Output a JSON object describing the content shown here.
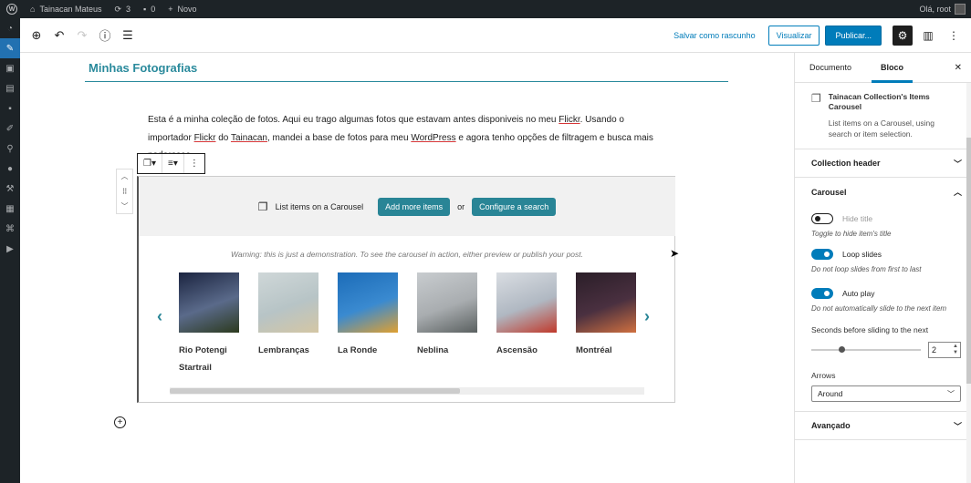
{
  "adminbar": {
    "site_name": "Tainacan Mateus",
    "updates": "3",
    "comments": "0",
    "new_label": "Novo",
    "greeting": "Olá, root"
  },
  "header": {
    "save_draft": "Salvar como rascunho",
    "preview": "Visualizar",
    "publish": "Publicar..."
  },
  "post": {
    "title": "Minhas Fotografias",
    "paragraph": {
      "p1": "Esta é a minha coleção de fotos. Aqui eu trago algumas fotos que estavam antes disponiveis no meu ",
      "flickr1": "Flickr",
      "p2": ". Usando o importador ",
      "flickr2": "Flickr",
      "p3": " do ",
      "tainacan": "Tainacan",
      "p4": ", mandei a base de fotos para meu ",
      "wordpress": "WordPress",
      "p5": " e agora tenho opções de filtragem e ",
      "hidden": "busca",
      "p6": " mais poderosas."
    }
  },
  "carousel_block": {
    "list_label": "List items on a Carousel",
    "add_more": "Add more items",
    "or": "or",
    "configure": "Configure a search",
    "warning": "Warning: this is just a demonstration. To see the carousel in action, either preview or publish your post.",
    "items": [
      {
        "label": "Rio Potengi Startrail",
        "colors": [
          "#1b2440",
          "#5a6a8a",
          "#2c3a1e"
        ]
      },
      {
        "label": "Lembranças",
        "colors": [
          "#cfd7d8",
          "#b7c4c6",
          "#d4c6a4"
        ]
      },
      {
        "label": "La Ronde",
        "colors": [
          "#1c6cb8",
          "#3a8ad0",
          "#e0a030"
        ]
      },
      {
        "label": "Neblina",
        "colors": [
          "#c8cccf",
          "#a9adb0",
          "#5a6060"
        ]
      },
      {
        "label": "Ascensão",
        "colors": [
          "#d9dde2",
          "#b0b8c2",
          "#c0392b"
        ]
      },
      {
        "label": "Montréal",
        "colors": [
          "#2a1e28",
          "#4a3040",
          "#d07040"
        ]
      }
    ]
  },
  "sidebar": {
    "tab_document": "Documento",
    "tab_block": "Bloco",
    "block_title": "Tainacan Collection's Items Carousel",
    "block_desc": "List items on a Carousel, using search or item selection.",
    "panel_collection_header": "Collection header",
    "panel_carousel": "Carousel",
    "hide_title": "Hide title",
    "hide_title_help": "Toggle to hide item's title",
    "loop_slides": "Loop slides",
    "loop_slides_help": "Do not loop slides from first to last",
    "auto_play": "Auto play",
    "auto_play_help": "Do not automatically slide to the next item",
    "seconds_label": "Seconds before sliding to the next",
    "seconds_value": "2",
    "arrows_label": "Arrows",
    "arrows_value": "Around",
    "panel_advanced": "Avançado"
  }
}
